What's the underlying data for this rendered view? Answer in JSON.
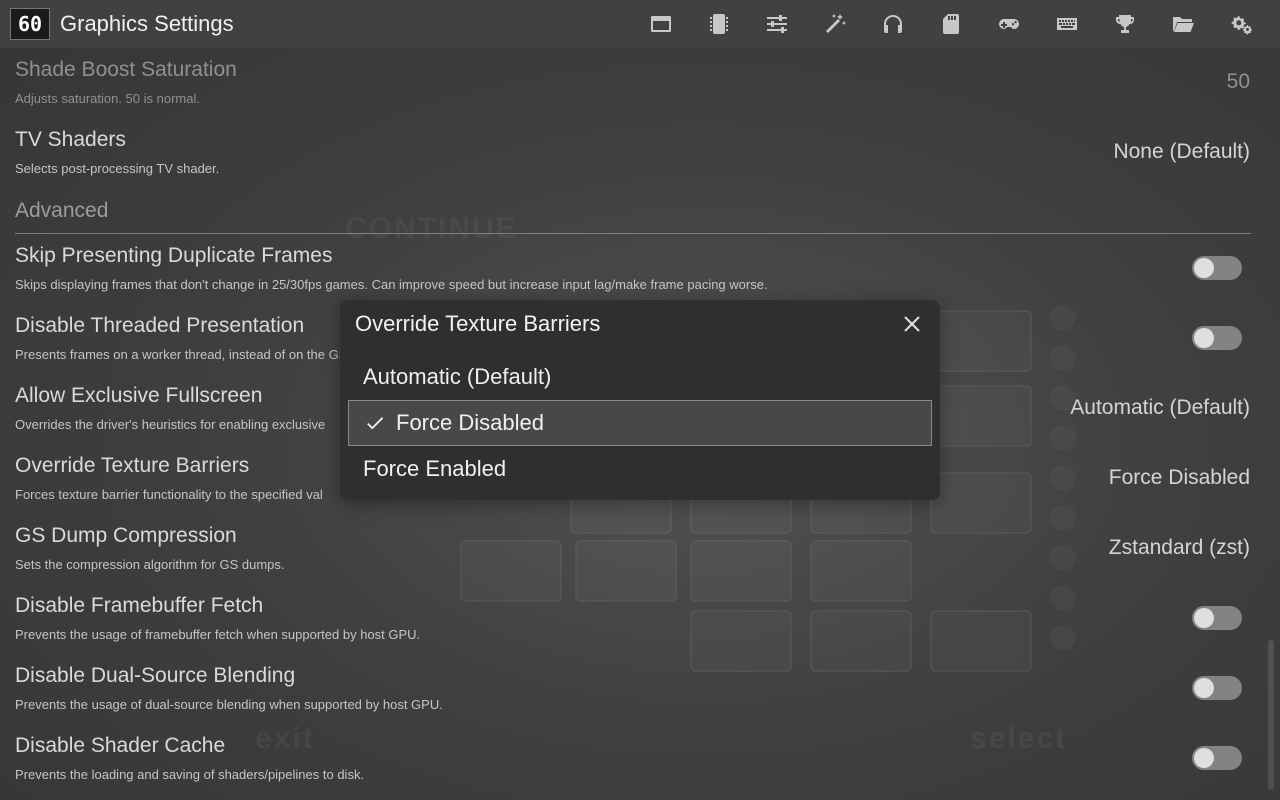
{
  "header": {
    "fps": "60",
    "title": "Graphics Settings",
    "icons": [
      "window-icon",
      "chip-icon",
      "sliders-icon",
      "magic-wand-icon",
      "headphones-icon",
      "memory-card-icon",
      "gamepad-icon",
      "keyboard-icon",
      "trophy-icon",
      "folder-icon",
      "gears-icon"
    ]
  },
  "settings": {
    "shade_boost": {
      "name": "Shade Boost Saturation",
      "desc": "Adjusts saturation. 50 is normal.",
      "value": "50"
    },
    "tv_shaders": {
      "name": "TV Shaders",
      "desc": "Selects post-processing TV shader.",
      "value": "None (Default)"
    },
    "advanced_label": "Advanced",
    "skip_dup": {
      "name": "Skip Presenting Duplicate Frames",
      "desc": "Skips displaying frames that don't change in 25/30fps games. Can improve speed but increase input lag/make frame pacing worse.",
      "on": false
    },
    "threaded": {
      "name": "Disable Threaded Presentation",
      "desc": "Presents frames on a worker thread, instead of on the GS thread. Can improve frame times on some systems, at the cost of potentially worse frame pacing.",
      "on": false
    },
    "exclusive_fs": {
      "name": "Allow Exclusive Fullscreen",
      "desc": "Overrides the driver's heuristics for enabling exclusive",
      "value": "Automatic (Default)"
    },
    "texture_barriers": {
      "name": "Override Texture Barriers",
      "desc": "Forces texture barrier functionality to the specified val",
      "value": "Force Disabled"
    },
    "gs_dump": {
      "name": "GS Dump Compression",
      "desc": "Sets the compression algorithm for GS dumps.",
      "value": "Zstandard (zst)"
    },
    "fb_fetch": {
      "name": "Disable Framebuffer Fetch",
      "desc": "Prevents the usage of framebuffer fetch when supported by host GPU.",
      "on": false
    },
    "dual_source": {
      "name": "Disable Dual-Source Blending",
      "desc": "Prevents the usage of dual-source blending when supported by host GPU.",
      "on": false
    },
    "shader_cache": {
      "name": "Disable Shader Cache",
      "desc": "Prevents the loading and saving of shaders/pipelines to disk.",
      "on": false
    }
  },
  "modal": {
    "title": "Override Texture Barriers",
    "options": [
      {
        "label": "Automatic (Default)",
        "selected": false
      },
      {
        "label": "Force Disabled",
        "selected": true
      },
      {
        "label": "Force Enabled",
        "selected": false
      }
    ]
  },
  "background": {
    "texts": [
      "CONTINUE",
      "exit",
      "select"
    ]
  }
}
